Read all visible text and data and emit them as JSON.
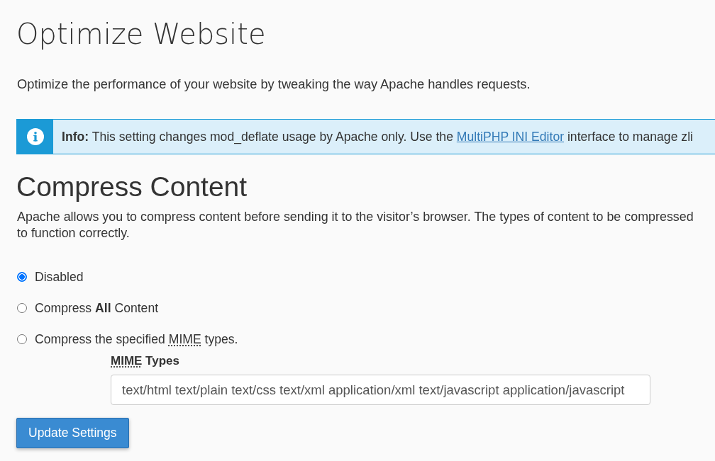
{
  "page": {
    "title": "Optimize Website",
    "description": "Optimize the performance of your website by tweaking the way Apache handles requests."
  },
  "info_alert": {
    "text_before": "**Info:** This setting changes mod_deflate usage by Apache only. Use the ",
    "link": "MultiPHP INI Editor",
    "text_after": " interface to manage zli"
  },
  "section": {
    "title": "Compress Content",
    "description_lines": [
      "Apache allows you to compress content before sending it to the visitor’s browser. The types of content to be compressed",
      "to function correctly."
    ]
  },
  "options": [
    {
      "segments": [
        {
          "kind": "plain",
          "text": "Disabled"
        }
      ],
      "selected": true
    },
    {
      "segments": [
        {
          "kind": "plain",
          "text": "Compress "
        },
        {
          "kind": "bold",
          "text": "All"
        },
        {
          "kind": "plain",
          "text": " Content"
        }
      ],
      "selected": false
    },
    {
      "segments": [
        {
          "kind": "plain",
          "text": "Compress the specified "
        },
        {
          "kind": "abbr",
          "text": "MIME"
        },
        {
          "kind": "plain",
          "text": " types."
        }
      ],
      "selected": false
    }
  ],
  "mime_field": {
    "label_segments": [
      {
        "kind": "abbr",
        "text": "MIME"
      },
      {
        "kind": "plain",
        "text": " Types"
      }
    ],
    "value": "text/html text/plain text/css text/xml application/xml text/javascript application/javascript"
  },
  "button": {
    "label": "Update Settings"
  }
}
